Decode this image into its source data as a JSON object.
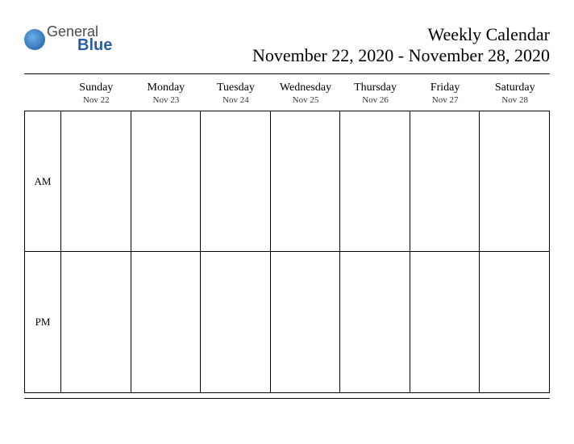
{
  "logo": {
    "line1": "General",
    "line2": "Blue"
  },
  "header": {
    "title": "Weekly Calendar",
    "date_range": "November 22, 2020 - November 28, 2020"
  },
  "periods": {
    "am": "AM",
    "pm": "PM"
  },
  "days": [
    {
      "name": "Sunday",
      "date": "Nov 22"
    },
    {
      "name": "Monday",
      "date": "Nov 23"
    },
    {
      "name": "Tuesday",
      "date": "Nov 24"
    },
    {
      "name": "Wednesday",
      "date": "Nov 25"
    },
    {
      "name": "Thursday",
      "date": "Nov 26"
    },
    {
      "name": "Friday",
      "date": "Nov 27"
    },
    {
      "name": "Saturday",
      "date": "Nov 28"
    }
  ]
}
